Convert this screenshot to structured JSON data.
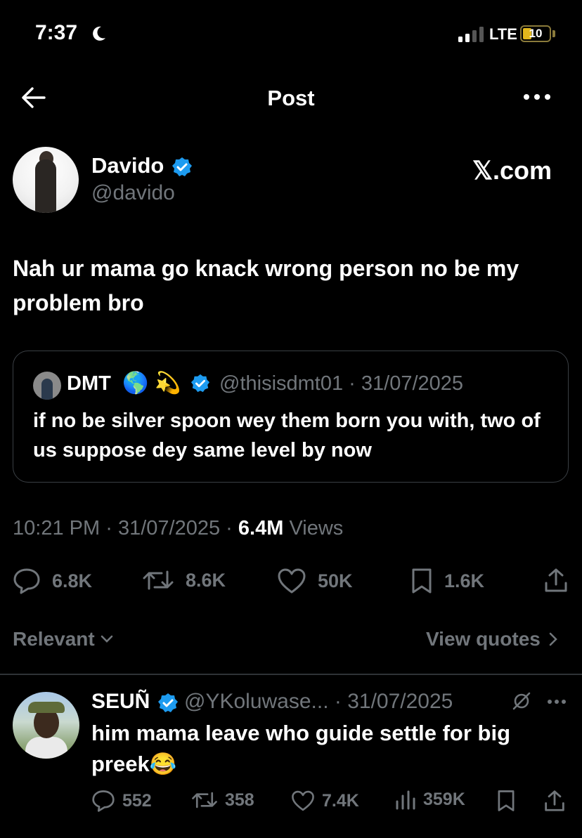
{
  "status_bar": {
    "time": "7:37",
    "network": "LTE",
    "battery_level": "10"
  },
  "nav": {
    "title": "Post"
  },
  "post": {
    "author_name": "Davido",
    "author_handle": "@davido",
    "watermark": "𝕏.com",
    "text": "Nah ur mama go knack wrong person no be my problem bro",
    "time": "10:21 PM",
    "date": "31/07/2025",
    "views_count": "6.4M",
    "views_label": "Views",
    "separator": "·",
    "replies": "6.8K",
    "reposts": "8.6K",
    "likes": "50K",
    "bookmarks": "1.6K"
  },
  "quote": {
    "name": "DMT",
    "emoji_1": "🌎",
    "emoji_2": "💫",
    "handle_date": "@thisisdmt01 · 31/07/2025",
    "text": "if no be silver spoon wey them born you with, two of us suppose dey same level by now"
  },
  "filter": {
    "sort_label": "Relevant",
    "view_quotes_label": "View quotes"
  },
  "reply": {
    "name": "SEUÑ",
    "handle_date": "@YKoluwase... · 31/07/2025",
    "text": "him mama leave who guide settle for big preek😂",
    "replies": "552",
    "reposts": "358",
    "likes": "7.4K",
    "views": "359K"
  },
  "colors": {
    "background": "#000000",
    "text": "#e7e9ea",
    "secondary": "#71767b",
    "verified": "#1d9bf0",
    "divider": "#2f3336"
  }
}
